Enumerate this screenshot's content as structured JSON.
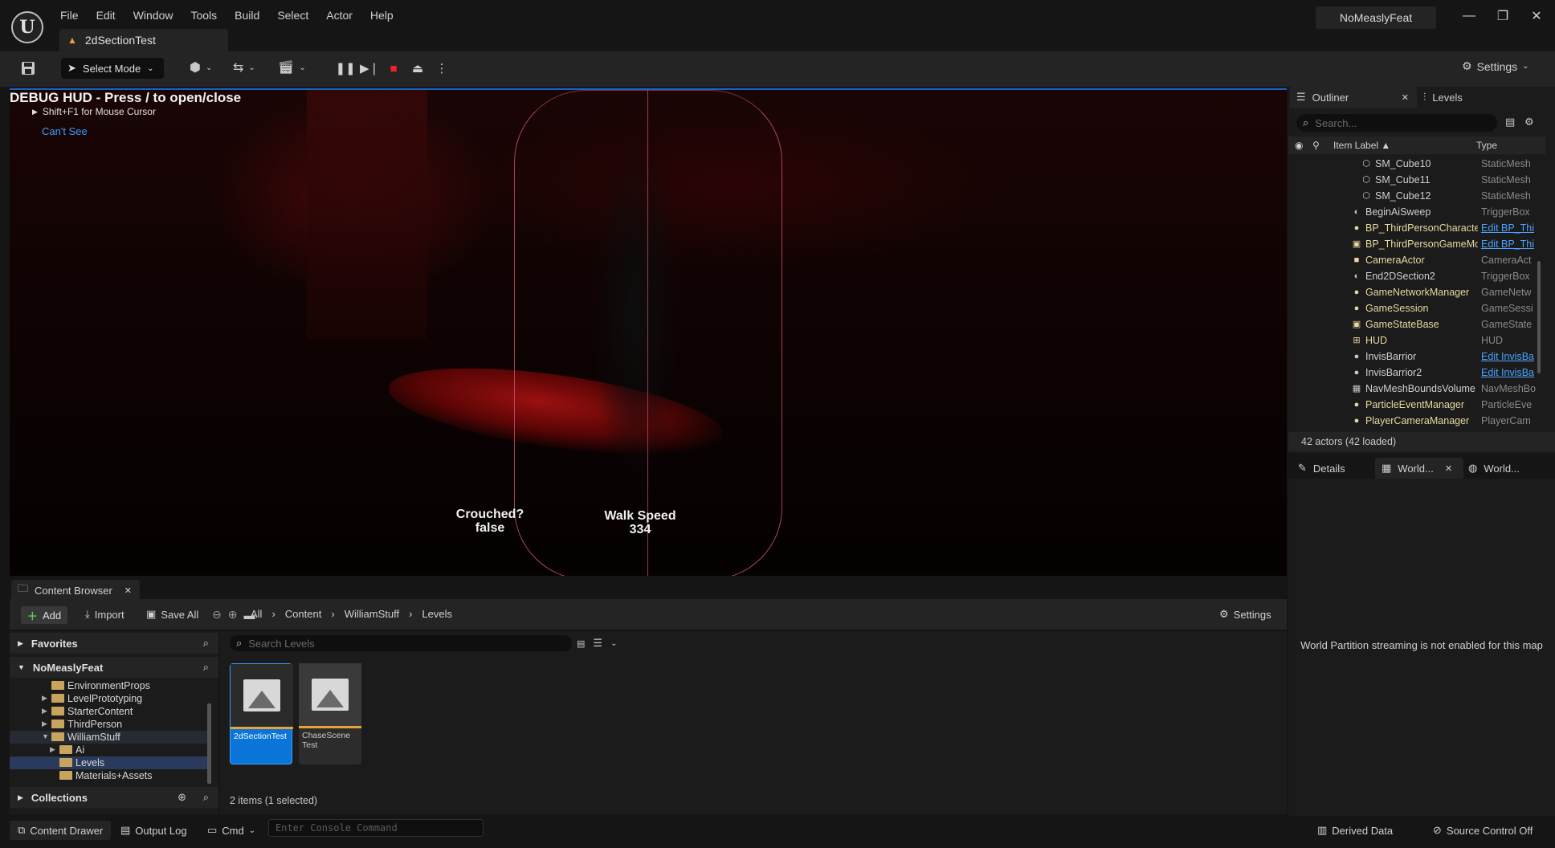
{
  "app": {
    "logo": "U",
    "menu": [
      "File",
      "Edit",
      "Window",
      "Tools",
      "Build",
      "Select",
      "Actor",
      "Help"
    ],
    "level_tab": "2dSectionTest",
    "project_name": "NoMeaslyFeat",
    "window_controls": {
      "minimize": "—",
      "restore": "❐",
      "close": "✕"
    }
  },
  "toolbar": {
    "select_mode": "Select Mode",
    "settings": "Settings"
  },
  "viewport": {
    "debug_title": "DEBUG HUD - Press / to open/close",
    "debug_hint": "Shift+F1 for Mouse Cursor",
    "cant_see": "Can't See",
    "crouched_label": "Crouched?",
    "crouched_value": "false",
    "walk_label": "Walk Speed",
    "walk_value": "334"
  },
  "outliner": {
    "tab_label": "Outliner",
    "levels_tab": "Levels",
    "search_placeholder": "Search...",
    "col_label": "Item Label ▲",
    "col_type": "Type",
    "rows": [
      {
        "label": "SM_Cube10",
        "type": "StaticMesh",
        "link": false,
        "indent": 2,
        "icon": "mesh-icon",
        "glyph": "⬡",
        "color": "#c8c8c8"
      },
      {
        "label": "SM_Cube11",
        "type": "StaticMesh",
        "link": false,
        "indent": 2,
        "icon": "mesh-icon",
        "glyph": "⬡",
        "color": "#c8c8c8"
      },
      {
        "label": "SM_Cube12",
        "type": "StaticMesh",
        "link": false,
        "indent": 2,
        "icon": "mesh-icon",
        "glyph": "⬡",
        "color": "#c8c8c8"
      },
      {
        "label": "BeginAiSweep",
        "type": "TriggerBox",
        "link": false,
        "indent": 1,
        "icon": "trigger-icon",
        "glyph": "◐",
        "color": "#c8c8c8"
      },
      {
        "label": "BP_ThirdPersonCharacter",
        "type": "Edit BP_Thi",
        "link": true,
        "indent": 1,
        "icon": "character-icon",
        "glyph": "●",
        "color": "#e8d9a0"
      },
      {
        "label": "BP_ThirdPersonGameMode",
        "type": "Edit BP_Thi",
        "link": true,
        "indent": 1,
        "icon": "gamemode-icon",
        "glyph": "▣",
        "color": "#e8d9a0"
      },
      {
        "label": "CameraActor",
        "type": "CameraAct",
        "link": false,
        "indent": 1,
        "icon": "camera-icon",
        "glyph": "■",
        "color": "#e8d9a0"
      },
      {
        "label": "End2DSection2",
        "type": "TriggerBox",
        "link": false,
        "indent": 1,
        "icon": "trigger-icon",
        "glyph": "◐",
        "color": "#c8c8c8"
      },
      {
        "label": "GameNetworkManager",
        "type": "GameNetw",
        "link": false,
        "indent": 1,
        "icon": "network-icon",
        "glyph": "●",
        "color": "#e8d9a0"
      },
      {
        "label": "GameSession",
        "type": "GameSessi",
        "link": false,
        "indent": 1,
        "icon": "session-icon",
        "glyph": "●",
        "color": "#e8d9a0"
      },
      {
        "label": "GameStateBase",
        "type": "GameState",
        "link": false,
        "indent": 1,
        "icon": "gamestate-icon",
        "glyph": "▣",
        "color": "#e8d9a0"
      },
      {
        "label": "HUD",
        "type": "HUD",
        "link": false,
        "indent": 1,
        "icon": "hud-icon",
        "glyph": "⊞",
        "color": "#e8d9a0"
      },
      {
        "label": "InvisBarrior",
        "type": "Edit InvisBa",
        "link": true,
        "indent": 1,
        "icon": "actor-icon",
        "glyph": "●",
        "color": "#c8c8c8"
      },
      {
        "label": "InvisBarrior2",
        "type": "Edit InvisBa",
        "link": true,
        "indent": 1,
        "icon": "actor-icon",
        "glyph": "●",
        "color": "#c8c8c8"
      },
      {
        "label": "NavMeshBoundsVolume",
        "type": "NavMeshBo",
        "link": false,
        "indent": 1,
        "icon": "navmesh-icon",
        "glyph": "▦",
        "color": "#c8c8c8"
      },
      {
        "label": "ParticleEventManager",
        "type": "ParticleEve",
        "link": false,
        "indent": 1,
        "icon": "particle-icon",
        "glyph": "●",
        "color": "#e8d9a0"
      },
      {
        "label": "PlayerCameraManager",
        "type": "PlayerCam",
        "link": false,
        "indent": 1,
        "icon": "cameramanager-icon",
        "glyph": "●",
        "color": "#e8d9a0"
      }
    ],
    "actor_count": "42 actors (42 loaded)"
  },
  "details": {
    "tab_details": "Details",
    "tab_world1": "World...",
    "tab_world2": "World...",
    "message": "World Partition streaming is not enabled for this map"
  },
  "content_browser": {
    "tab_label": "Content Browser",
    "add": "Add",
    "import": "Import",
    "save_all": "Save All",
    "breadcrumb": [
      "All",
      "Content",
      "WilliamStuff",
      "Levels"
    ],
    "settings": "Settings",
    "favorites": "Favorites",
    "project": "NoMeaslyFeat",
    "collections": "Collections",
    "folders": [
      {
        "name": "EnvironmentProps",
        "depth": 1,
        "arrow": "",
        "selected": false
      },
      {
        "name": "LevelPrototyping",
        "depth": 1,
        "arrow": "▶",
        "selected": false
      },
      {
        "name": "StarterContent",
        "depth": 1,
        "arrow": "▶",
        "selected": false
      },
      {
        "name": "ThirdPerson",
        "depth": 1,
        "arrow": "▶",
        "selected": false
      },
      {
        "name": "WilliamStuff",
        "depth": 1,
        "arrow": "▼",
        "selected": false,
        "highlight": true
      },
      {
        "name": "Ai",
        "depth": 2,
        "arrow": "▶",
        "selected": false
      },
      {
        "name": "Levels",
        "depth": 2,
        "arrow": "",
        "selected": true
      },
      {
        "name": "Materials+Assets",
        "depth": 2,
        "arrow": "",
        "selected": false
      }
    ],
    "search_placeholder": "Search Levels",
    "assets": [
      {
        "name": "2dSectionTest"
      },
      {
        "name": "ChaseScene Test"
      }
    ],
    "items_count": "2 items (1 selected)"
  },
  "statusbar": {
    "content_drawer": "Content Drawer",
    "output_log": "Output Log",
    "cmd": "Cmd",
    "console_placeholder": "Enter Console Command",
    "derived_data": "Derived Data",
    "source_control": "Source Control Off"
  },
  "colors": {
    "accent": "#0a74d8",
    "link": "#4aa3ff",
    "stop": "#e22222",
    "warning": "#e8a23a"
  }
}
